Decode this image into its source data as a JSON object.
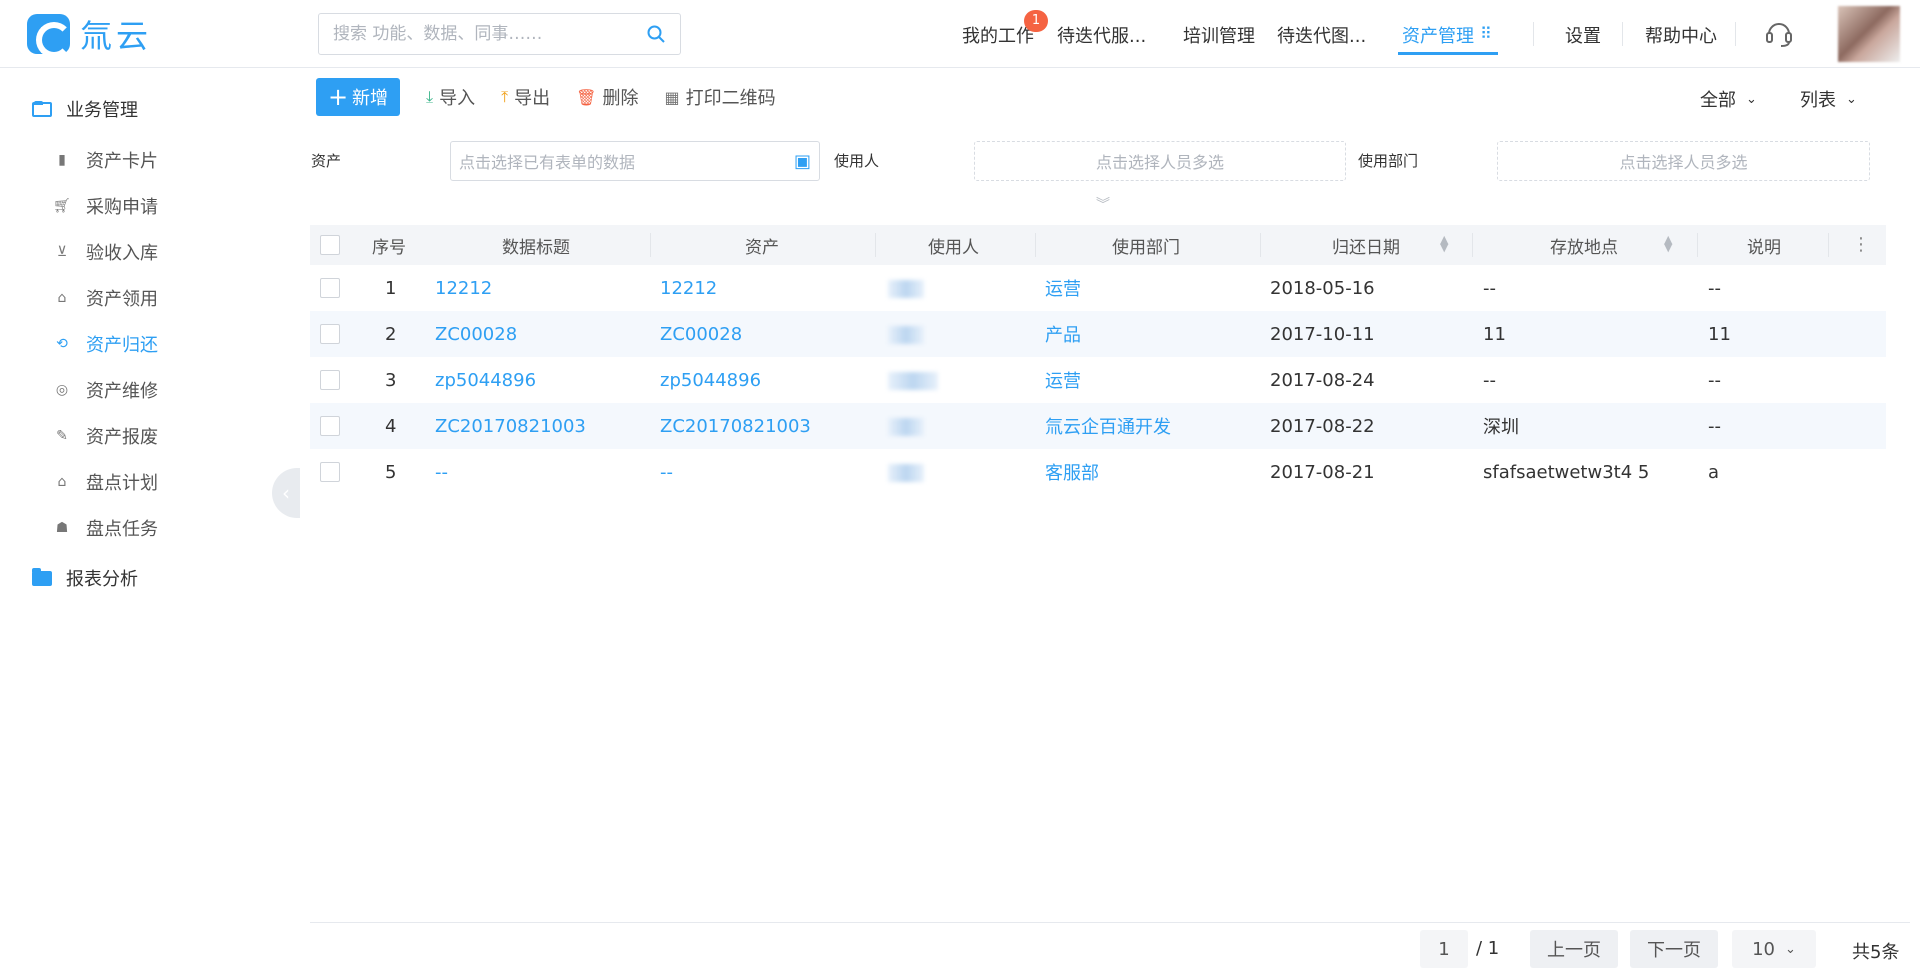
{
  "app": {
    "logo_text": "氚云"
  },
  "search": {
    "placeholder": "搜索 功能、数据、同事……"
  },
  "nav": {
    "items": [
      {
        "label": "我的工作",
        "badge": "1"
      },
      {
        "label": "待迭代服..."
      },
      {
        "label": "培训管理"
      },
      {
        "label": "待迭代图..."
      },
      {
        "label": "资产管理"
      },
      {
        "label": "设置"
      },
      {
        "label": "帮助中心"
      }
    ]
  },
  "sidebar": {
    "groups": [
      {
        "label": "业务管理"
      },
      {
        "label": "报表分析"
      }
    ],
    "items": [
      {
        "label": "资产卡片",
        "icon": "card-icon"
      },
      {
        "label": "采购申请",
        "icon": "cart-icon"
      },
      {
        "label": "验收入库",
        "icon": "basket-icon"
      },
      {
        "label": "资产领用",
        "icon": "building-icon"
      },
      {
        "label": "资产归还",
        "icon": "return-icon"
      },
      {
        "label": "资产维修",
        "icon": "repair-icon"
      },
      {
        "label": "资产报废",
        "icon": "scrap-icon"
      },
      {
        "label": "盘点计划",
        "icon": "bank-icon"
      },
      {
        "label": "盘点任务",
        "icon": "users-icon"
      }
    ]
  },
  "toolbar": {
    "add": "新增",
    "import": "导入",
    "export": "导出",
    "delete": "删除",
    "print_qr": "打印二维码",
    "scope": "全部",
    "view": "列表"
  },
  "filters": {
    "asset_label": "资产",
    "asset_placeholder": "点击选择已有表单的数据",
    "user_label": "使用人",
    "user_placeholder": "点击选择人员多选",
    "dept_label": "使用部门",
    "dept_placeholder": "点击选择人员多选"
  },
  "table": {
    "headers": [
      "序号",
      "数据标题",
      "资产",
      "使用人",
      "使用部门",
      "归还日期",
      "存放地点",
      "说明"
    ],
    "rows": [
      {
        "no": "1",
        "title": "12212",
        "asset": "12212",
        "user": "",
        "dept": "运营",
        "date": "2018-05-16",
        "location": "--",
        "note": "--"
      },
      {
        "no": "2",
        "title": "ZC00028",
        "asset": "ZC00028",
        "user": "",
        "dept": "产品",
        "date": "2017-10-11",
        "location": "11",
        "note": "11"
      },
      {
        "no": "3",
        "title": "zp5044896",
        "asset": "zp5044896",
        "user": "",
        "dept": "运营",
        "date": "2017-08-24",
        "location": "--",
        "note": "--"
      },
      {
        "no": "4",
        "title": "ZC20170821003",
        "asset": "ZC20170821003",
        "user": "",
        "dept": "氚云企百通开发",
        "date": "2017-08-22",
        "location": "深圳",
        "note": "--"
      },
      {
        "no": "5",
        "title": "--",
        "asset": "--",
        "user": "",
        "dept": "客服部",
        "date": "2017-08-21",
        "location": "sfafsaetwetw3t4 5",
        "note": "a"
      }
    ]
  },
  "pager": {
    "current": "1",
    "total_pages": "/ 1",
    "prev": "上一页",
    "next": "下一页",
    "page_size": "10",
    "total": "共5条"
  }
}
